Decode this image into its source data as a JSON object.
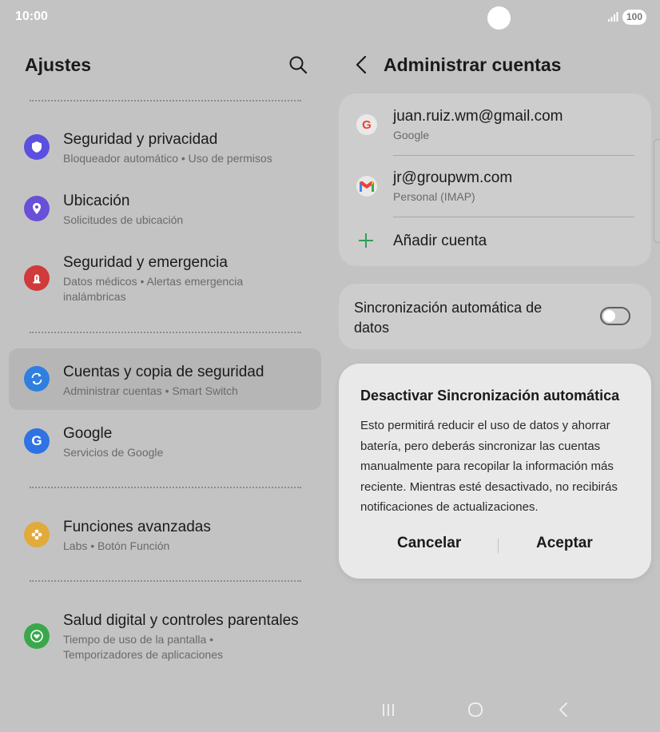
{
  "status_bar": {
    "time": "10:00",
    "battery": "100"
  },
  "left": {
    "title": "Ajustes",
    "items": [
      {
        "title": "Seguridad y privacidad",
        "subtitle": "Bloqueador automático  •  Uso de permisos"
      },
      {
        "title": "Ubicación",
        "subtitle": "Solicitudes de ubicación"
      },
      {
        "title": "Seguridad y emergencia",
        "subtitle": "Datos médicos  •  Alertas emergencia inalámbricas"
      },
      {
        "title": "Cuentas y copia de seguridad",
        "subtitle": "Administrar cuentas  •  Smart Switch"
      },
      {
        "title": "Google",
        "subtitle": "Servicios de Google"
      },
      {
        "title": "Funciones avanzadas",
        "subtitle": "Labs  •  Botón Función"
      },
      {
        "title": "Salud digital y controles parentales",
        "subtitle": "Tiempo de uso de la pantalla  •  Temporizadores de aplicaciones"
      }
    ]
  },
  "right": {
    "title": "Administrar cuentas",
    "accounts": [
      {
        "email": "juan.ruiz.wm@gmail.com",
        "type": "Google"
      },
      {
        "email": "jr@groupwm.com",
        "type": "Personal (IMAP)"
      }
    ],
    "add_account": "Añadir cuenta",
    "sync_label": "Sincronización automática de datos",
    "sync_enabled": false
  },
  "dialog": {
    "title": "Desactivar Sincronización automática",
    "body": "Esto permitirá reducir el uso de datos y ahorrar batería, pero deberás sincronizar las cuentas manualmente para recopilar la información más reciente. Mientras esté desactivado, no recibirás notificaciones de actualizaciones.",
    "cancel": "Cancelar",
    "accept": "Aceptar"
  },
  "icons": {
    "security": "shield-icon",
    "location": "location-pin-icon",
    "emergency": "emergency-icon",
    "accounts": "sync-icon",
    "google": "google-g-icon",
    "advanced": "gear-flower-icon",
    "wellbeing": "heart-circle-icon"
  },
  "colors": {
    "security": "#5b4fe0",
    "location": "#6a4fd8",
    "emergency": "#d03a3a",
    "accounts": "#2f7fe0",
    "google": "#2f72e4",
    "advanced": "#e2a93b",
    "wellbeing": "#3aa84a",
    "add_plus": "#2f9e5a"
  }
}
